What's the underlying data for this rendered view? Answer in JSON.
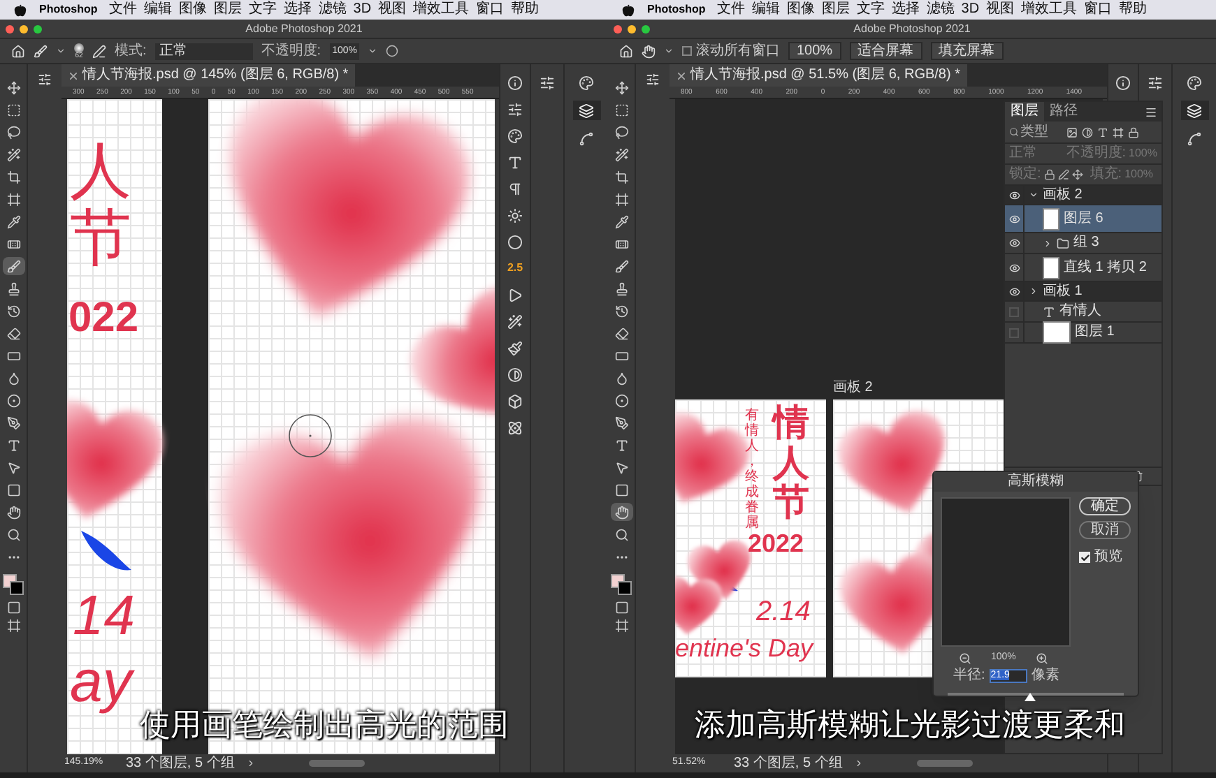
{
  "panes": [
    {
      "kind": "brush",
      "menubar": {
        "app": "Photoshop",
        "menus": [
          "文件",
          "编辑",
          "图像",
          "图层",
          "文字",
          "选择",
          "滤镜",
          "3D",
          "视图",
          "增效工具",
          "窗口",
          "帮助"
        ]
      },
      "window_title": "Adobe Photoshop 2021",
      "options": {
        "brush_size": "62",
        "mode_label": "模式:",
        "mode": "正常",
        "opacity_label": "不透明度:",
        "opacity": "100%"
      },
      "document_tab": "情人节海报.psd @ 145% (图层 6, RGB/8) *",
      "ruler": [
        "300",
        "250",
        "200",
        "150",
        "100",
        "50",
        "0",
        "50",
        "100",
        "150",
        "200",
        "250",
        "300",
        "350",
        "400",
        "450",
        "500",
        "550"
      ],
      "canvas": {
        "texts": [
          "人节",
          "022",
          "14",
          "ay"
        ]
      },
      "panel_value": "2.5",
      "status": {
        "zoom": "145.19%",
        "info": "33 个图层, 5 个组"
      },
      "subtitle": "使用画笔绘制出高光的范围"
    },
    {
      "kind": "hand",
      "menubar": {
        "app": "Photoshop",
        "menus": [
          "文件",
          "编辑",
          "图像",
          "图层",
          "文字",
          "选择",
          "滤镜",
          "3D",
          "视图",
          "增效工具",
          "窗口",
          "帮助"
        ]
      },
      "window_title": "Adobe Photoshop 2021",
      "options": {
        "scroll_all": {
          "label": "滚动所有窗口",
          "checked": false
        },
        "buttons": [
          "100%",
          "适合屏幕",
          "填充屏幕"
        ]
      },
      "document_tab": "情人节海报.psd @ 51.5% (图层 6, RGB/8) *",
      "ruler": [
        "800",
        "600",
        "400",
        "200",
        "0",
        "200",
        "400",
        "600",
        "800",
        "1000",
        "1200",
        "1400"
      ],
      "canvas": {
        "artboard_label": "画板 2",
        "poster": {
          "title": "情人节",
          "tagline": "有情人，终成眷属",
          "year": "2022",
          "date": "2.14",
          "slogan": "entine's Day"
        }
      },
      "layers_panel": {
        "tabs": [
          {
            "label": "图层",
            "selected": true
          },
          {
            "label": "路径",
            "selected": false
          }
        ],
        "filter": "类型",
        "mode": "正常",
        "opacity_label": "不透明度:",
        "opacity": "100%",
        "lock_label": "锁定:",
        "fill_label": "填充:",
        "fill": "100%",
        "layers": [
          {
            "name": "画板 2",
            "kind": "artboard",
            "visible": true,
            "selected": false,
            "expanded": true,
            "children": [
              {
                "name": "图层 6",
                "kind": "layer",
                "visible": true,
                "selected": true
              },
              {
                "name": "组 3",
                "kind": "group",
                "visible": true,
                "selected": false,
                "expanded": false
              },
              {
                "name": "直线 1 拷贝 2",
                "kind": "shape",
                "visible": true,
                "selected": false
              }
            ]
          },
          {
            "name": "画板 1",
            "kind": "artboard",
            "visible": true,
            "selected": false,
            "expanded": false
          },
          {
            "name": "有情人",
            "kind": "text",
            "visible": false,
            "selected": false
          },
          {
            "name": "图层 1",
            "kind": "image",
            "visible": false,
            "selected": false
          }
        ]
      },
      "dialog": {
        "title": "高斯模糊",
        "ok": "确定",
        "cancel": "取消",
        "preview": {
          "label": "预览",
          "checked": true
        },
        "zoom": "100%",
        "radius_label": "半径:",
        "radius": "21.9",
        "unit": "像素",
        "level": 0.47
      },
      "status": {
        "zoom": "51.52%",
        "info": "33 个图层, 5 个组"
      },
      "subtitle": "添加高斯模糊让光影过渡更柔和"
    }
  ]
}
